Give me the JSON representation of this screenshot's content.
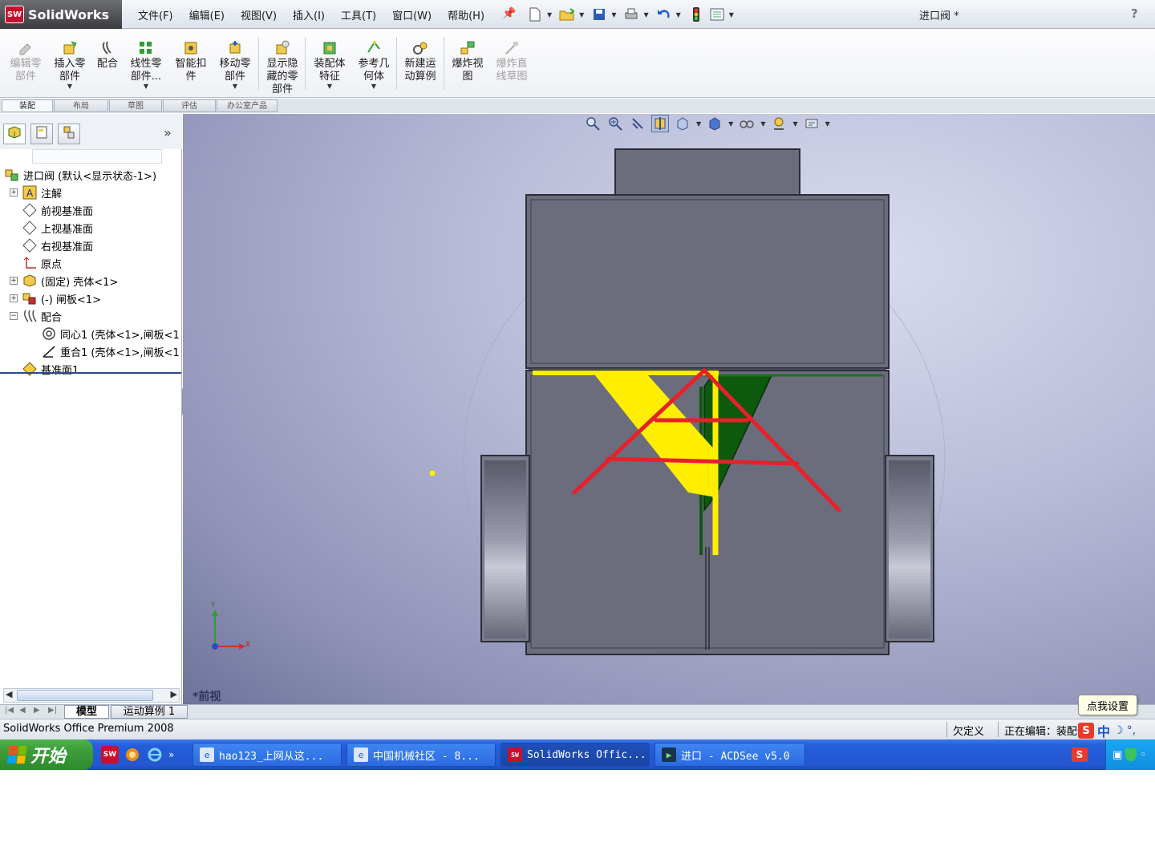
{
  "app": {
    "logo_badge": "SW",
    "logo_text": "SolidWorks",
    "document_title": "进口阀 *",
    "help_icon": "?"
  },
  "menus": [
    "文件(F)",
    "编辑(E)",
    "视图(V)",
    "插入(I)",
    "工具(T)",
    "窗口(W)",
    "帮助(H)"
  ],
  "quick_access": [
    "new-document-icon",
    "open-folder-icon",
    "save-icon",
    "print-icon",
    "undo-icon",
    "rebuild-traffic-light-icon",
    "options-icon"
  ],
  "commands": [
    {
      "line1": "编辑零",
      "line2": "部件",
      "line3": "",
      "disabled": true,
      "icon": "edit-component-icon"
    },
    {
      "line1": "插入零",
      "line2": "部件",
      "line3": "",
      "disabled": false,
      "icon": "insert-components-icon",
      "dropdown": true
    },
    {
      "line1": "配合",
      "line2": "",
      "line3": "",
      "disabled": false,
      "icon": "mate-icon"
    },
    {
      "line1": "线性零",
      "line2": "部件...",
      "line3": "",
      "disabled": false,
      "icon": "linear-pattern-icon",
      "dropdown": true
    },
    {
      "line1": "智能扣",
      "line2": "件",
      "line3": "",
      "disabled": false,
      "icon": "smart-fasteners-icon"
    },
    {
      "line1": "移动零",
      "line2": "部件",
      "line3": "",
      "disabled": false,
      "icon": "move-component-icon",
      "dropdown": true
    },
    {
      "line1": "显示隐",
      "line2": "藏的零",
      "line3": "部件",
      "disabled": false,
      "icon": "show-hidden-components-icon"
    },
    {
      "line1": "装配体",
      "line2": "特征",
      "line3": "",
      "disabled": false,
      "icon": "assembly-features-icon",
      "dropdown": true
    },
    {
      "line1": "参考几",
      "line2": "何体",
      "line3": "",
      "disabled": false,
      "icon": "reference-geometry-icon",
      "dropdown": true
    },
    {
      "line1": "新建运",
      "line2": "动算例",
      "line3": "",
      "disabled": false,
      "icon": "new-motion-study-icon"
    },
    {
      "line1": "爆炸视",
      "line2": "图",
      "line3": "",
      "disabled": false,
      "icon": "exploded-view-icon"
    },
    {
      "line1": "爆炸直",
      "line2": "线草图",
      "line3": "",
      "disabled": true,
      "icon": "explode-line-sketch-icon"
    }
  ],
  "cmd_tabs": [
    "装配",
    "布局",
    "草图",
    "评估",
    "办公室产品"
  ],
  "feature_tree": {
    "root": "进口阀 (默认<显示状态-1>)",
    "items": [
      {
        "label": "注解",
        "icon": "annotations-icon",
        "expander": "+"
      },
      {
        "label": "前视基准面",
        "icon": "plane-icon",
        "expander": ""
      },
      {
        "label": "上视基准面",
        "icon": "plane-icon",
        "expander": ""
      },
      {
        "label": "右视基准面",
        "icon": "plane-icon",
        "expander": ""
      },
      {
        "label": "原点",
        "icon": "origin-icon",
        "expander": ""
      },
      {
        "label": "(固定) 壳体<1>",
        "icon": "part-icon",
        "expander": "+"
      },
      {
        "label": "(-) 闸板<1>",
        "icon": "part-icon",
        "expander": "+"
      },
      {
        "label": "配合",
        "icon": "mates-folder-icon",
        "expander": "−"
      },
      {
        "label": "同心1 (壳体<1>,闸板<1",
        "icon": "concentric-mate-icon",
        "expander": "",
        "child": true
      },
      {
        "label": "重合1 (壳体<1>,闸板<1",
        "icon": "coincident-mate-icon",
        "expander": "",
        "child": true
      },
      {
        "label": "基准面1",
        "icon": "plane-feature-icon",
        "expander": ""
      }
    ]
  },
  "viewport": {
    "view_name": "*前视",
    "triad_x": "X",
    "triad_y": "Y"
  },
  "bottom_tabs": [
    "模型",
    "运动算例 1"
  ],
  "status": {
    "product": "SolidWorks Office Premium 2008",
    "definition": "欠定义",
    "editing": "正在编辑：装配体"
  },
  "tooltip": "点我设置",
  "ime": {
    "badge": "S",
    "lang": "中"
  },
  "taskbar": {
    "start": "开始",
    "buttons": [
      {
        "label": "hao123_上网从这...",
        "icon": "ie-page-icon"
      },
      {
        "label": "中国机械社区 - 8...",
        "icon": "ie-page-icon"
      },
      {
        "label": "SolidWorks Offic...",
        "icon": "solidworks-icon",
        "active": true
      },
      {
        "label": "进口 - ACDSee v5.0",
        "icon": "acdsee-icon"
      }
    ]
  },
  "colors": {
    "model_body": "#6b6d7d",
    "yellow_markup": "#ffee00",
    "red_markup": "#e8202a",
    "green_part": "#0d5a0d",
    "taskbar": "#245edb"
  }
}
